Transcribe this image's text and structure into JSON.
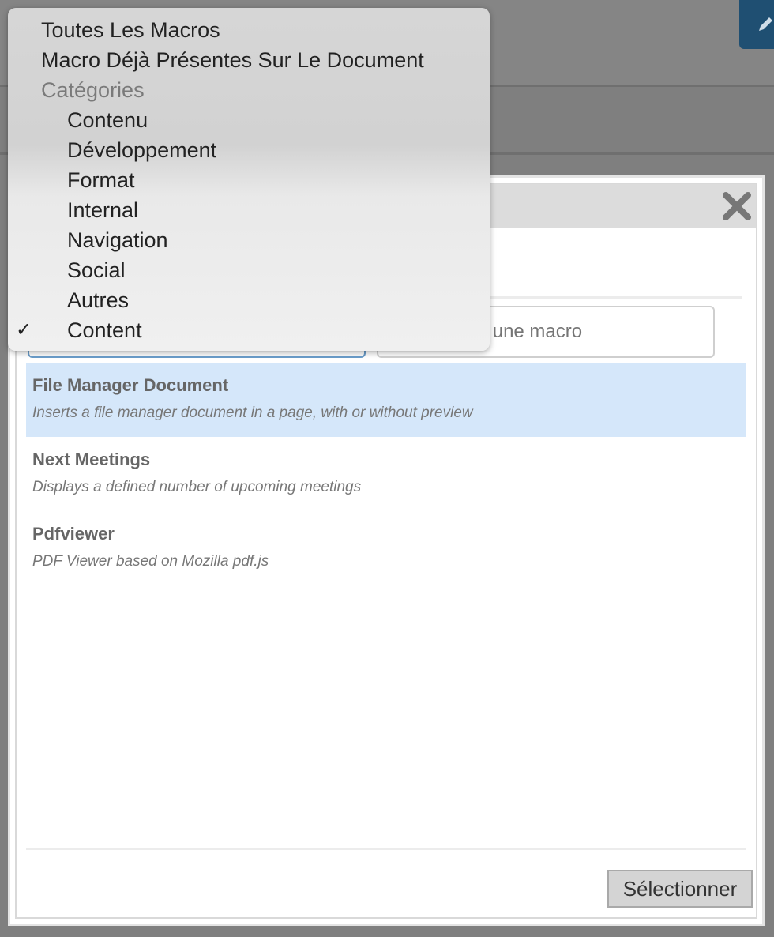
{
  "background": {
    "edit_icon": "pencil-icon",
    "edit_button_color": "#1f4f72"
  },
  "modal": {
    "close_icon": "close-icon",
    "search": {
      "value": "",
      "placeholder": "Rechercher une macro"
    },
    "macros": [
      {
        "name": "File Manager Document",
        "description": "Inserts a file manager document in a page, with or without preview",
        "selected": true
      },
      {
        "name": "Next Meetings",
        "description": "Displays a defined number of upcoming meetings",
        "selected": false
      },
      {
        "name": "Pdfviewer",
        "description": "PDF Viewer based on Mozilla pdf.js",
        "selected": false
      }
    ],
    "select_button_label": "Sélectionner",
    "selection_color": "#d5e7fa"
  },
  "dropdown": {
    "options": [
      {
        "label": "Toutes Les Macros"
      },
      {
        "label": "Macro Déjà Présentes Sur Le Document"
      }
    ],
    "group_label": "Catégories",
    "categories": [
      {
        "label": "Contenu",
        "checked": false
      },
      {
        "label": "Développement",
        "checked": false
      },
      {
        "label": "Format",
        "checked": false
      },
      {
        "label": "Internal",
        "checked": false
      },
      {
        "label": "Navigation",
        "checked": false
      },
      {
        "label": "Social",
        "checked": false
      },
      {
        "label": "Autres",
        "checked": false
      },
      {
        "label": "Content",
        "checked": true
      }
    ],
    "check_symbol": "✓"
  }
}
